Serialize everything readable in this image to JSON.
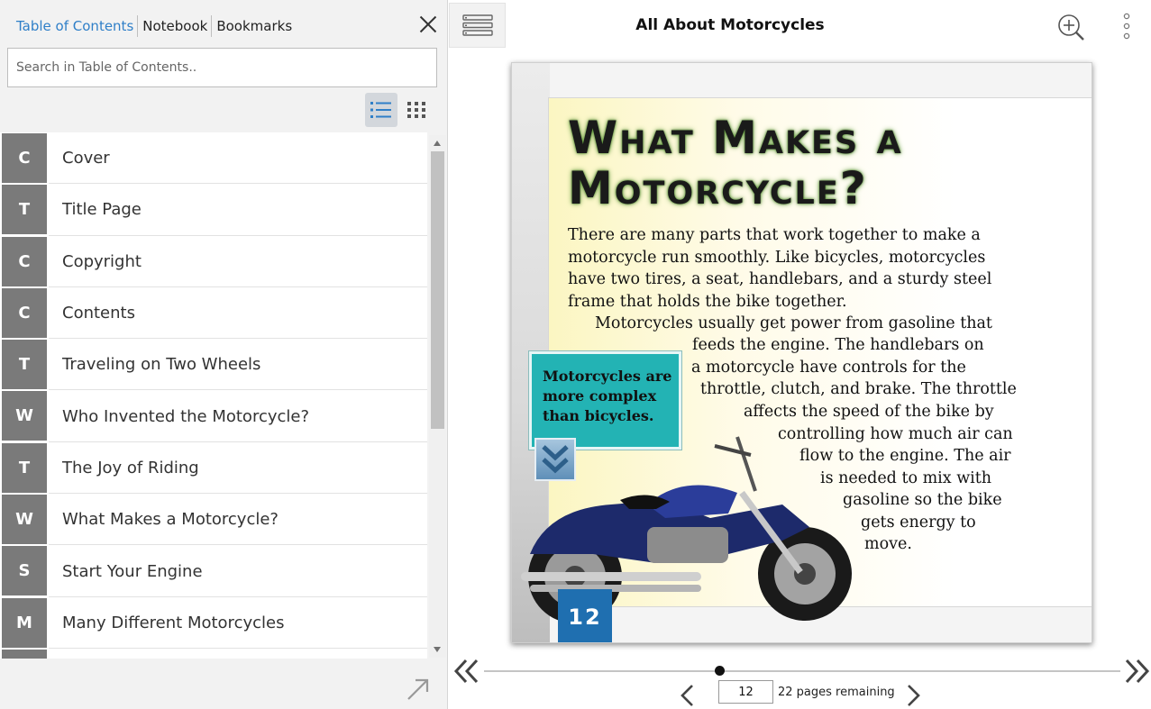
{
  "sidebar": {
    "tabs": [
      {
        "label": "Table of Contents",
        "active": true
      },
      {
        "label": "Notebook",
        "active": false
      },
      {
        "label": "Bookmarks",
        "active": false
      }
    ],
    "search_placeholder": "Search in Table of Contents..",
    "toc": [
      {
        "letter": "C",
        "label": "Cover"
      },
      {
        "letter": "T",
        "label": "Title Page"
      },
      {
        "letter": "C",
        "label": "Copyright"
      },
      {
        "letter": "C",
        "label": "Contents"
      },
      {
        "letter": "T",
        "label": "Traveling on Two Wheels"
      },
      {
        "letter": "W",
        "label": "Who Invented the Motorcycle?"
      },
      {
        "letter": "T",
        "label": "The Joy of Riding"
      },
      {
        "letter": "W",
        "label": "What Makes a Motorcycle?"
      },
      {
        "letter": "S",
        "label": "Start Your Engine"
      },
      {
        "letter": "M",
        "label": "Many Different Motorcycles"
      },
      {
        "letter": "",
        "label": ""
      }
    ]
  },
  "header": {
    "title": "All About Motorcycles"
  },
  "page": {
    "headline_line1": "What Makes a",
    "headline_line2": "Motorcycle?",
    "paragraph_lines": [
      "There are many parts that work together to make a",
      "motorcycle run smoothly. Like bicycles, motorcycles",
      "have two tires, a seat, handlebars, and a sturdy steel",
      "frame that holds the bike together."
    ],
    "paragraph2_lines": [
      "Motorcycles usually get power from gasoline that",
      "feeds the engine. The handlebars on",
      "a motorcycle have controls for the",
      "throttle, clutch, and brake. The throttle",
      "affects the speed of the bike by",
      "controlling how much air can",
      "flow to the engine. The air",
      "is needed to mix with",
      "gasoline so the bike",
      "gets energy to",
      "move."
    ],
    "callout": "Motorcycles are more complex than bicycles.",
    "page_number": "12"
  },
  "navigation": {
    "current_page": "12",
    "pages_remaining": "22 pages remaining",
    "progress": 0.37
  },
  "colors": {
    "accent": "#2f7fc8",
    "badge": "#7a7a7a",
    "callout": "#23b3b4",
    "page_number_bg": "#1f6fb0"
  }
}
